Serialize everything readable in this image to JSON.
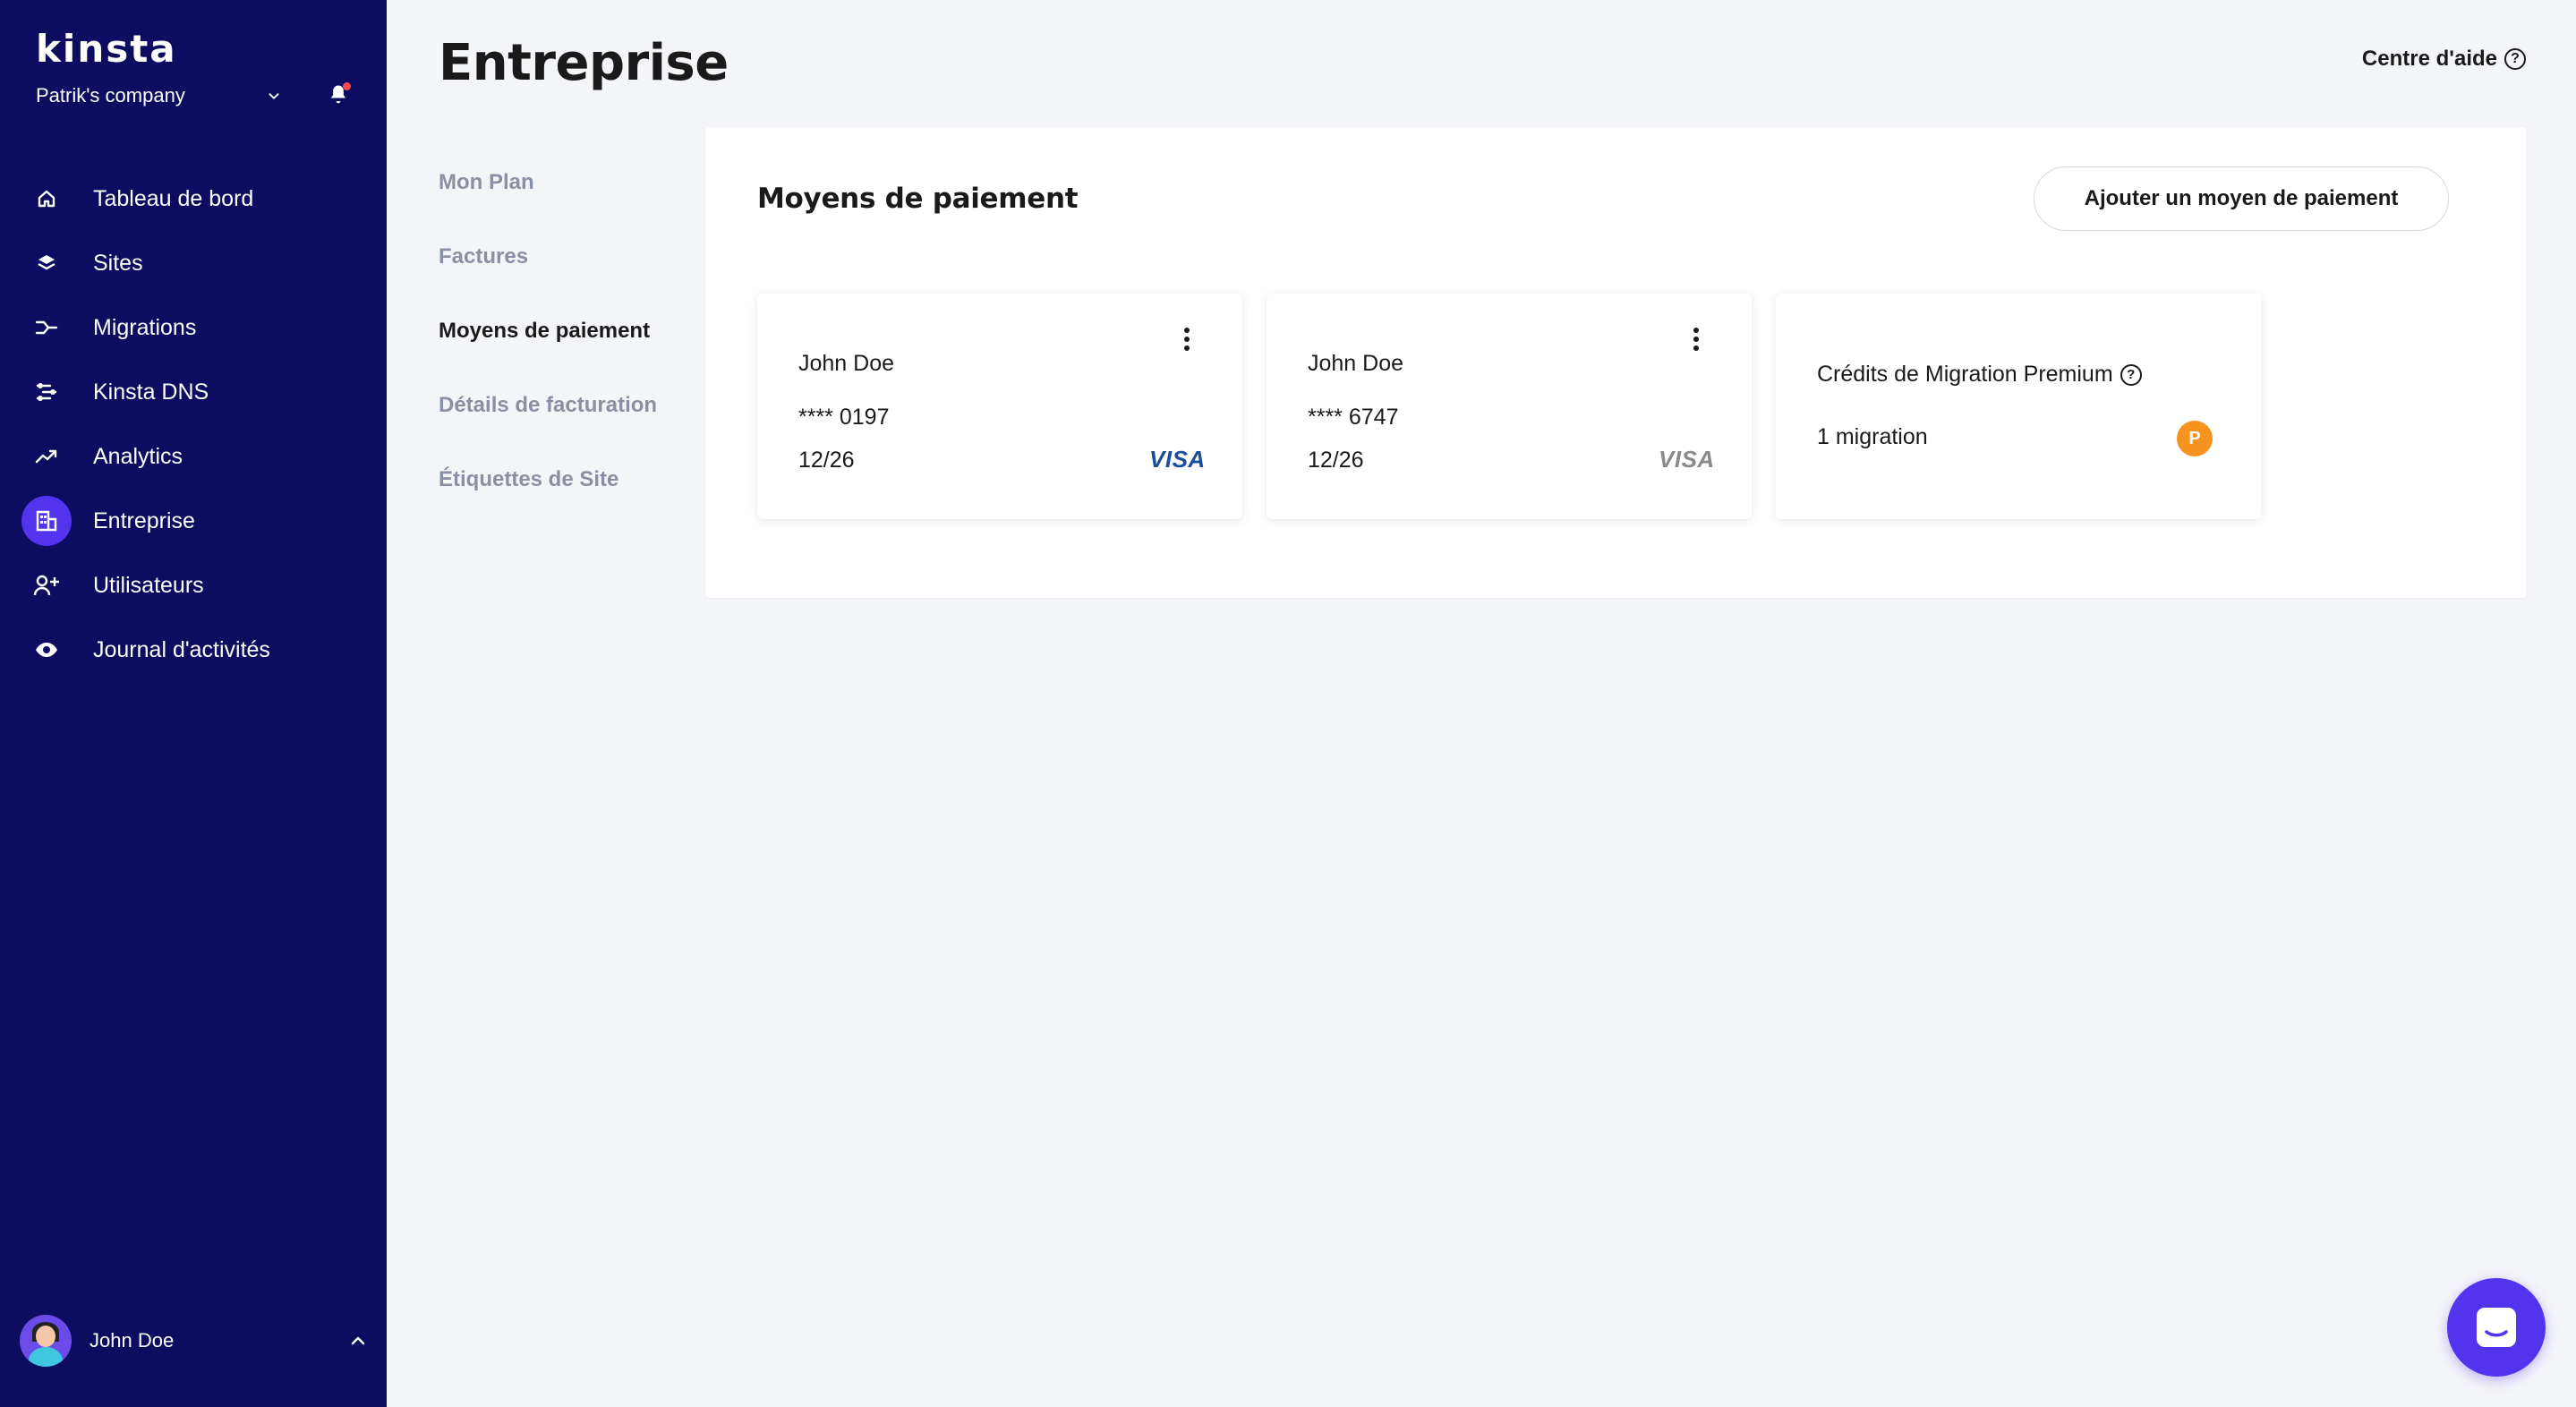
{
  "app": {
    "logo": "kinsta",
    "company": "Patrik's company"
  },
  "sidebar": {
    "items": [
      {
        "label": "Tableau de bord",
        "icon": "home-icon",
        "active": false
      },
      {
        "label": "Sites",
        "icon": "layers-icon",
        "active": false
      },
      {
        "label": "Migrations",
        "icon": "migrations-icon",
        "active": false
      },
      {
        "label": "Kinsta DNS",
        "icon": "dns-icon",
        "active": false
      },
      {
        "label": "Analytics",
        "icon": "trend-up-icon",
        "active": false
      },
      {
        "label": "Entreprise",
        "icon": "company-icon",
        "active": true
      },
      {
        "label": "Utilisateurs",
        "icon": "add-user-icon",
        "active": false
      },
      {
        "label": "Journal d'activités",
        "icon": "eye-icon",
        "active": false
      }
    ],
    "user": {
      "name": "John Doe"
    }
  },
  "header": {
    "title": "Entreprise",
    "help": "Centre d'aide"
  },
  "subnav": {
    "items": [
      {
        "label": "Mon Plan",
        "active": false
      },
      {
        "label": "Factures",
        "active": false
      },
      {
        "label": "Moyens de paiement",
        "active": true
      },
      {
        "label": "Détails de facturation",
        "active": false
      },
      {
        "label": "Étiquettes de Site",
        "active": false
      }
    ]
  },
  "panel": {
    "title": "Moyens de paiement",
    "add_button": "Ajouter un moyen de paiement",
    "cards": [
      {
        "name": "John Doe",
        "number": "**** 0197",
        "expiry": "12/26",
        "brand": "VISA"
      },
      {
        "name": "John Doe",
        "number": "**** 6747",
        "expiry": "12/26",
        "brand": "VISA"
      }
    ],
    "credits": {
      "title": "Crédits de Migration Premium",
      "count": "1 migration",
      "badge": "P"
    }
  },
  "colors": {
    "sidebar_bg": "#0d0c61",
    "accent": "#5333ed",
    "premium_badge": "#f6931e"
  }
}
